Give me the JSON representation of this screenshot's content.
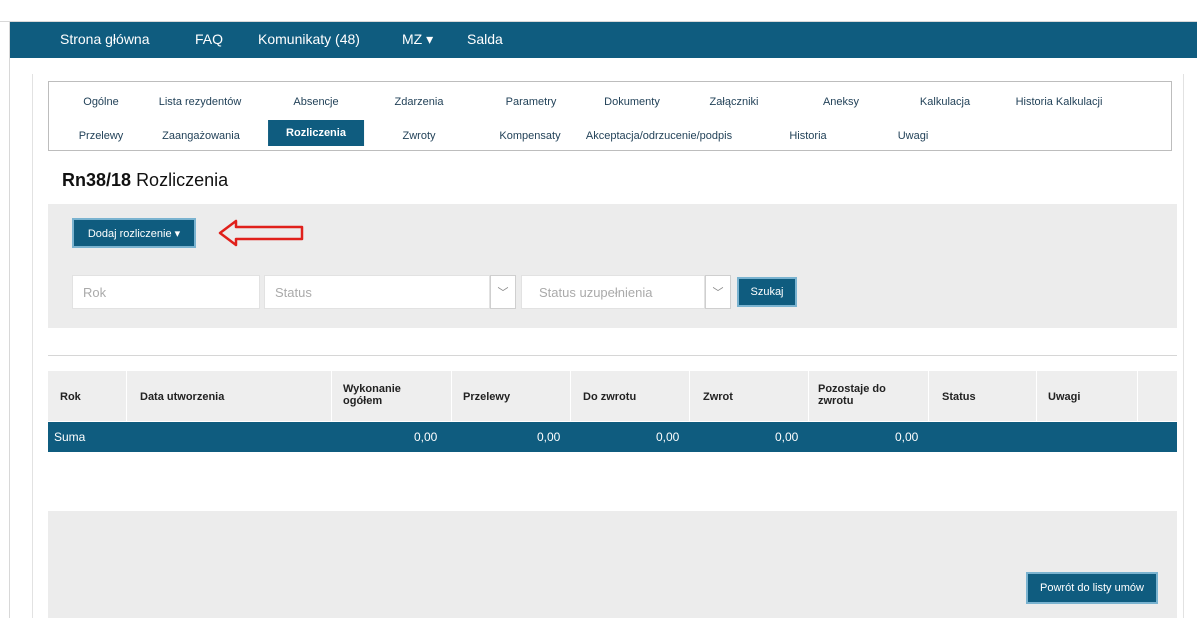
{
  "nav": {
    "items": [
      "Strona główna",
      "FAQ",
      "Komunikaty (48)",
      "MZ ▾",
      "Salda"
    ]
  },
  "tabs": {
    "row1": [
      "Ogólne",
      "Lista rezydentów",
      "Absencje",
      "Zdarzenia",
      "Parametry",
      "Dokumenty",
      "Załączniki",
      "Aneksy",
      "Kalkulacja",
      "Historia Kalkulacji"
    ],
    "row2": [
      "Przelewy",
      "Zaangażowania",
      "Rozliczenia",
      "Zwroty",
      "Kompensaty",
      "Akceptacja/odrzucenie/podpis",
      "Historia",
      "Uwagi"
    ],
    "active": "Rozliczenia"
  },
  "title": {
    "code": "Rn38/18",
    "name": "Rozliczenia"
  },
  "filters": {
    "add_button": "Dodaj rozliczenie ▾",
    "year_placeholder": "Rok",
    "status_placeholder": "Status",
    "completion_placeholder": "Status uzupełnienia",
    "search_button": "Szukaj"
  },
  "table": {
    "headers": [
      "Rok",
      "Data utworzenia",
      "Wykonanie ogółem",
      "Przelewy",
      "Do zwrotu",
      "Zwrot",
      "Pozostaje do zwrotu",
      "Status",
      "Uwagi"
    ],
    "sum_label": "Suma",
    "sum_values": [
      "0,00",
      "0,00",
      "0,00",
      "0,00",
      "0,00"
    ]
  },
  "footer": {
    "back_button": "Powrót do listy umów"
  },
  "colors": {
    "primary": "#0f5c7f",
    "panel": "#ececec",
    "annotation_arrow": "#e0201b"
  }
}
